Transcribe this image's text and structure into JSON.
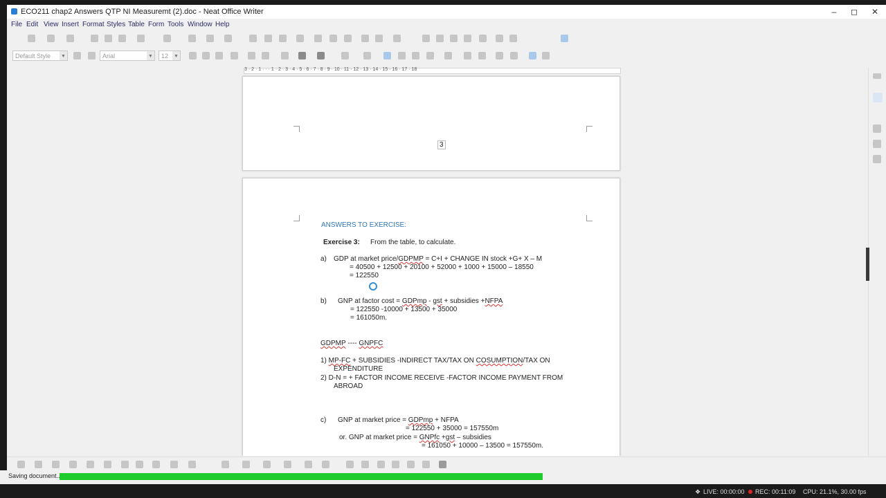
{
  "window": {
    "title": "ECO211 chap2 Answers QTP NI Measuremt (2).doc - Neat Office Writer"
  },
  "menu": [
    "File",
    "Edit",
    "View",
    "Insert",
    "Format",
    "Styles",
    "Table",
    "Form",
    "Tools",
    "Window",
    "Help"
  ],
  "formatting": {
    "paragraph_style": "Default Style",
    "font_name": "Arial",
    "font_size": "12"
  },
  "ruler": {
    "labels": "3 · 2 · 1 · · · 1 · 2 · 3 · 4 · 5 · 6 · 7 · 8 · 9 · 10 · 11 · 12 · 13 · 14 · 15 · 16 · 17 · 18"
  },
  "page_prev": {
    "page_number": "3"
  },
  "document": {
    "heading": "ANSWERS TO EXERCISE:",
    "exercise": {
      "label": "Exercise 3:",
      "text": "From the table, to calculate."
    },
    "a": {
      "marker": "a)",
      "line1_pre": "GDP at market price/",
      "line1_sq": "GDPMP",
      "line1_post": " = C+I + CHANGE IN stock +G+ X – M",
      "line2": "= 40500 + 12500 + 20100 + 52000 + 1000 + 15000 – 18550",
      "line3": "= 122550"
    },
    "b": {
      "marker": "b)",
      "line1_pre": "GNP at factor cost  = ",
      "line1_sq1": "GDPmp",
      "line1_mid": " - ",
      "line1_sq2": "gst",
      "line1_post": " + subsidies +",
      "line1_sq3": "NFPA",
      "line2": "= 122550 -10000 + 13500  + 35000",
      "line3": "= 161050m."
    },
    "gd": {
      "left": "GDPMP",
      "dash": " ---- ",
      "right": "GNPFC"
    },
    "rule1": {
      "pre": "1) ",
      "sq1": "MP-FC",
      "mid": "  + SUBSIDIES -INDIRECT TAX/TAX ON ",
      "sq2": "COSUMPTION",
      "post": "/TAX ON",
      "line2": "EXPENDITURE"
    },
    "rule2": {
      "line1": "2) D-N = + FACTOR INCOME RECEIVE -FACTOR INCOME PAYMENT FROM",
      "line2": "ABROAD"
    },
    "c": {
      "marker": "c)",
      "line1_pre": "GNP at market price =  ",
      "line1_sq": "GDPmp",
      "line1_post": " + NFPA",
      "line2": "= 122550 + 35000 = 157550m",
      "line3_pre": "or.  GNP at market price = ",
      "line3_sq1": "GNPfc",
      "line3_mid": " +",
      "line3_sq2": "gst",
      "line3_post": " – subsidies",
      "line4": "= 161050 + 10000 – 13500 = 157550m."
    }
  },
  "status": {
    "text": "Saving document...",
    "progress_percent": 100
  },
  "recorder": {
    "live": "LIVE: 00:00:00",
    "rec": "REC: 00:11:09",
    "cpu": "CPU: 21.1%, 30.00 fps"
  },
  "colors": {
    "heading": "#2e75b6",
    "progress": "#1ecc2c",
    "rec_dot": "#e02424"
  }
}
